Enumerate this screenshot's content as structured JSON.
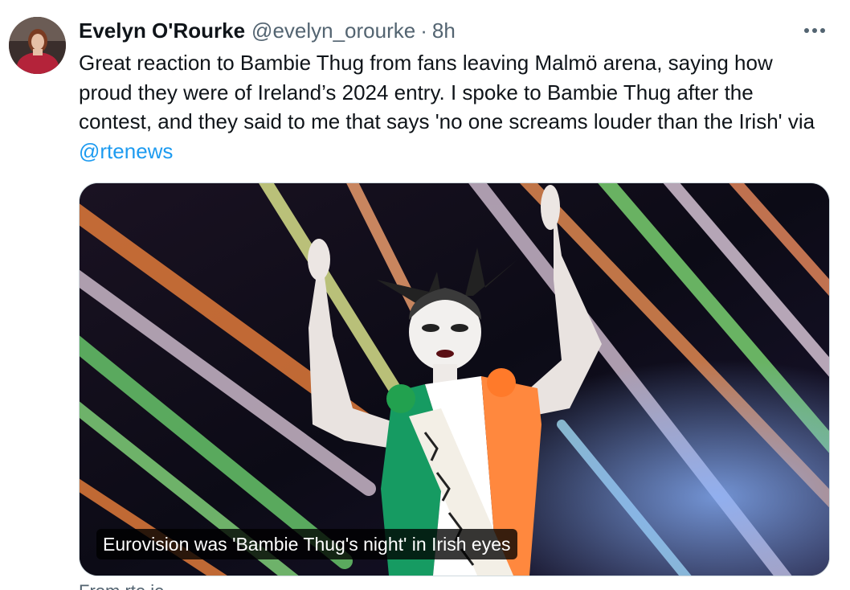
{
  "author": {
    "name": "Evelyn O'Rourke",
    "handle": "@evelyn_orourke",
    "separator": "·",
    "timestamp": "8h"
  },
  "tweet": {
    "text": "Great reaction to Bambie Thug from fans leaving Malmö arena, saying how proud they were of Ireland’s 2024 entry. I spoke to Bambie Thug after the contest, and they said to me that says 'no one screams louder than the Irish' via ",
    "mention": "@rtenews"
  },
  "card": {
    "caption": "Eurovision was 'Bambie Thug's night' in Irish eyes",
    "source": "From rte.ie"
  },
  "icons": {
    "more": "more-horizontal-icon",
    "avatar": "avatar-image"
  },
  "colors": {
    "link": "#1d9bf0",
    "secondary_text": "#536471",
    "primary_text": "#0f1419",
    "flag_green": "#169b62",
    "flag_white": "#ffffff",
    "flag_orange": "#ff883e"
  }
}
